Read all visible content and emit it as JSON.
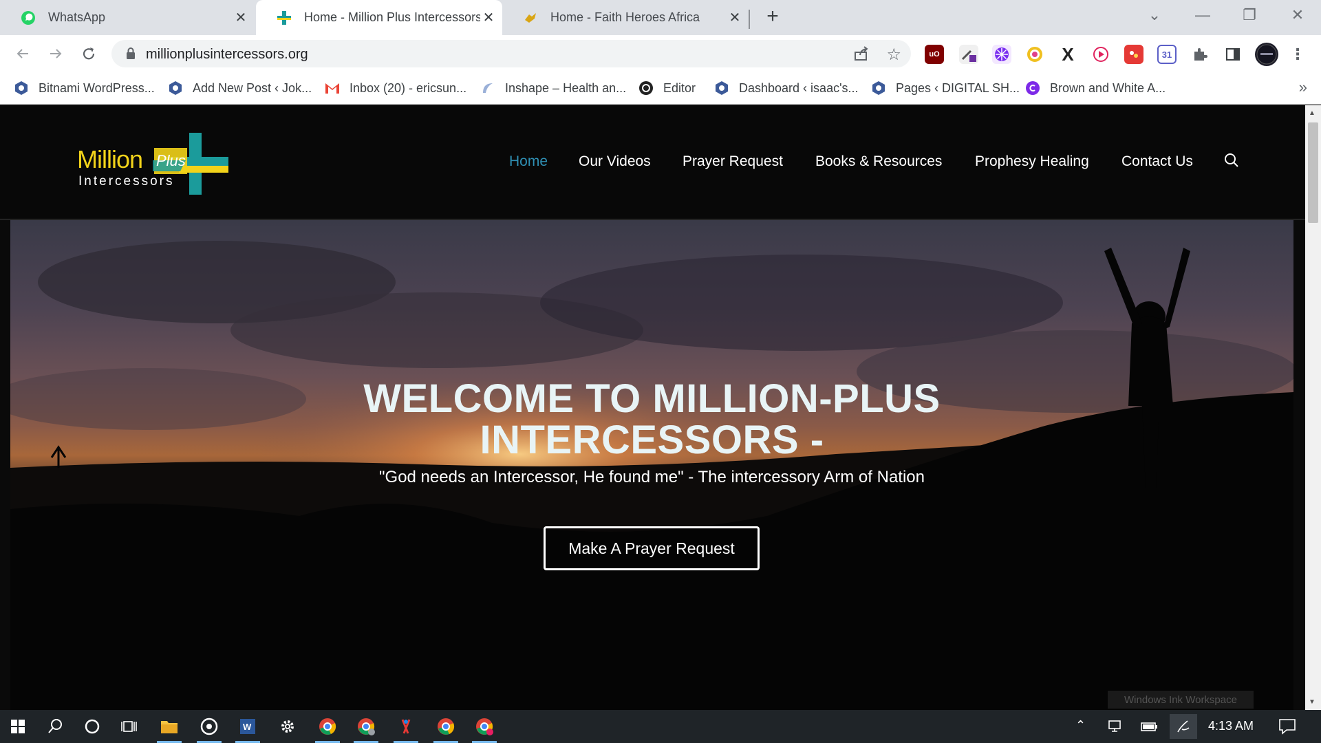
{
  "browser": {
    "tabs": [
      {
        "title": "WhatsApp",
        "favicon": "whatsapp-icon",
        "active": false
      },
      {
        "title": "Home - Million Plus Intercessors",
        "favicon": "cross-icon",
        "active": true
      },
      {
        "title": "Home - Faith Heroes Africa",
        "favicon": "hand-icon",
        "active": false
      }
    ],
    "url": "millionplusintercessors.org",
    "bookmarks": [
      {
        "label": "Bitnami WordPress...",
        "icon": "wordpress-hex-icon"
      },
      {
        "label": "Add New Post ‹ Jok...",
        "icon": "wordpress-hex-icon"
      },
      {
        "label": "Inbox (20) - ericsun...",
        "icon": "gmail-icon"
      },
      {
        "label": "Inshape – Health an...",
        "icon": "inshape-icon"
      },
      {
        "label": "Editor",
        "icon": "editor-icon"
      },
      {
        "label": "Dashboard ‹ isaac's...",
        "icon": "wordpress-hex-icon"
      },
      {
        "label": "Pages ‹ DIGITAL SH...",
        "icon": "wordpress-hex-icon"
      },
      {
        "label": "Brown and White A...",
        "icon": "canva-icon"
      }
    ],
    "more_bookmarks": "»"
  },
  "site": {
    "logo_text_main": "Million",
    "logo_text_plus": "Plus",
    "logo_text_sub": "Intercessors",
    "nav": [
      {
        "label": "Home",
        "current": true
      },
      {
        "label": "Our Videos",
        "current": false
      },
      {
        "label": "Prayer Request",
        "current": false
      },
      {
        "label": "Books & Resources",
        "current": false
      },
      {
        "label": "Prophesy Healing",
        "current": false
      },
      {
        "label": "Contact Us",
        "current": false
      }
    ],
    "hero": {
      "title_line1": "WELCOME TO MILLION-PLUS",
      "title_line2": "INTERCESSORS -",
      "subtitle": "\"God needs an Intercessor, He found me\" - The intercessory Arm of Nation",
      "button": "Make A Prayer Request"
    },
    "ink_tip": "Windows Ink Workspace"
  },
  "taskbar": {
    "time": "4:13 AM"
  },
  "colors": {
    "nav_active": "#2f8fb3",
    "logo_yellow": "#f2d31a",
    "logo_teal": "#1b9b9b"
  }
}
